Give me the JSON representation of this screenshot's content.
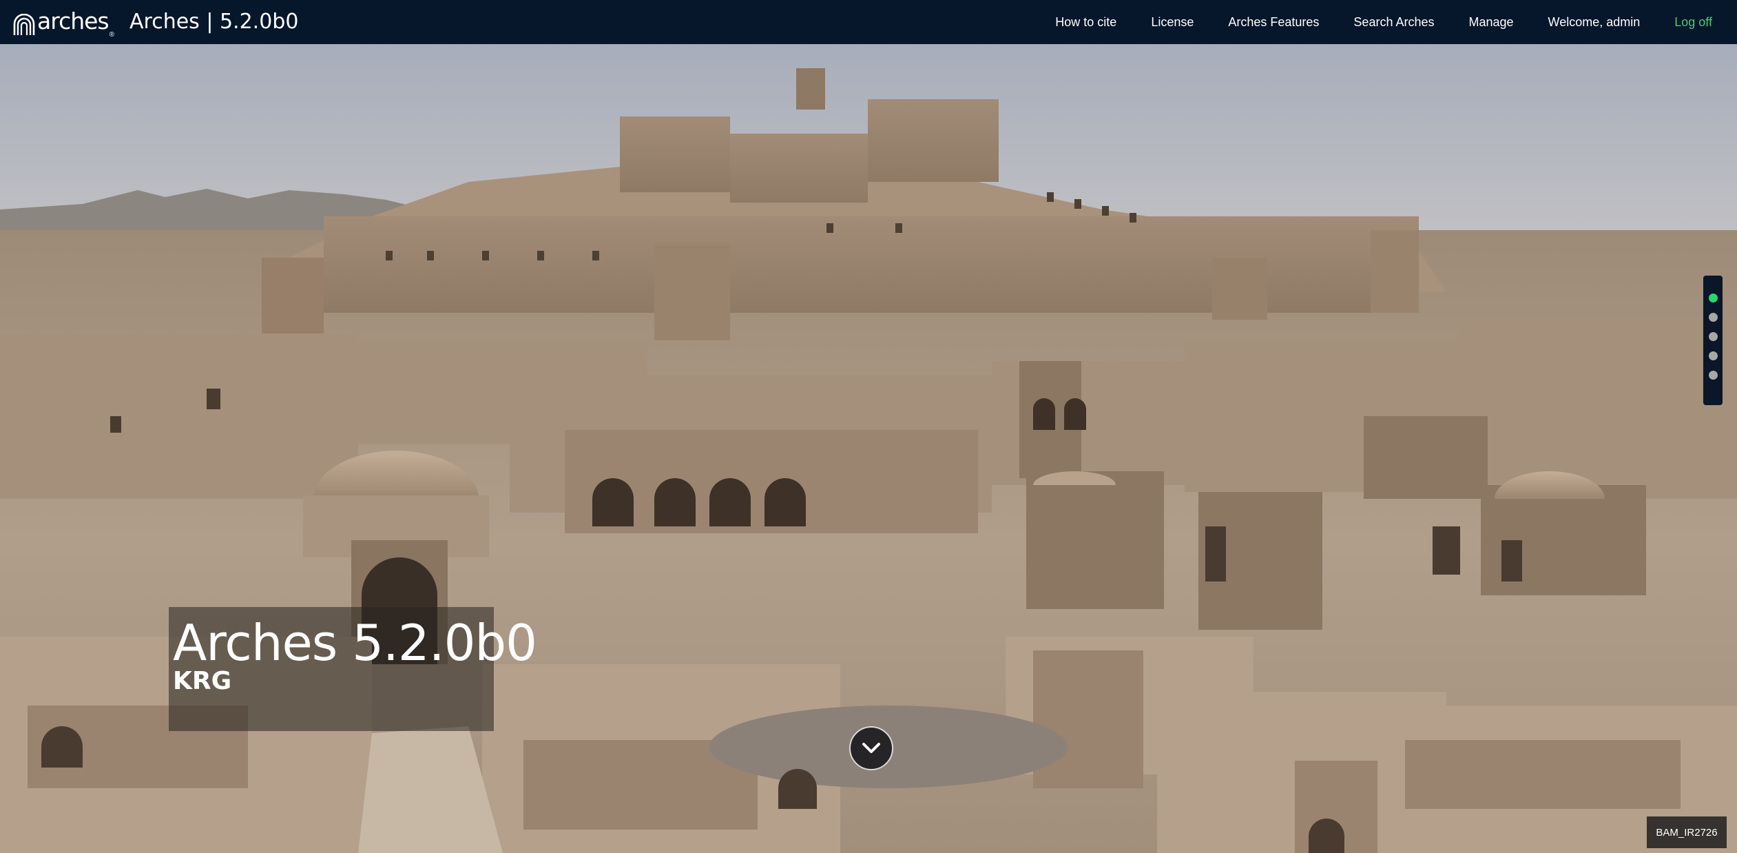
{
  "navbar": {
    "brand_wordmark": "arches",
    "app_title": "Arches | 5.2.0b0",
    "links": [
      {
        "label": "How to cite"
      },
      {
        "label": "License"
      },
      {
        "label": "Arches Features"
      },
      {
        "label": "Search Arches"
      },
      {
        "label": "Manage"
      },
      {
        "label": "Welcome, admin"
      },
      {
        "label": "Log off"
      }
    ],
    "colors": {
      "background": "#06162b",
      "logoff": "#3fd171"
    }
  },
  "hero": {
    "title": "Arches 5.2.0b0",
    "subtitle": "KRG",
    "image_caption": "BAM_IR2726",
    "scroll_icon": "chevron-down-icon",
    "slides": {
      "count": 5,
      "active_index": 0
    },
    "colors": {
      "active_dot": "#2bd46f",
      "inactive_dot": "#a7a7a7"
    }
  }
}
